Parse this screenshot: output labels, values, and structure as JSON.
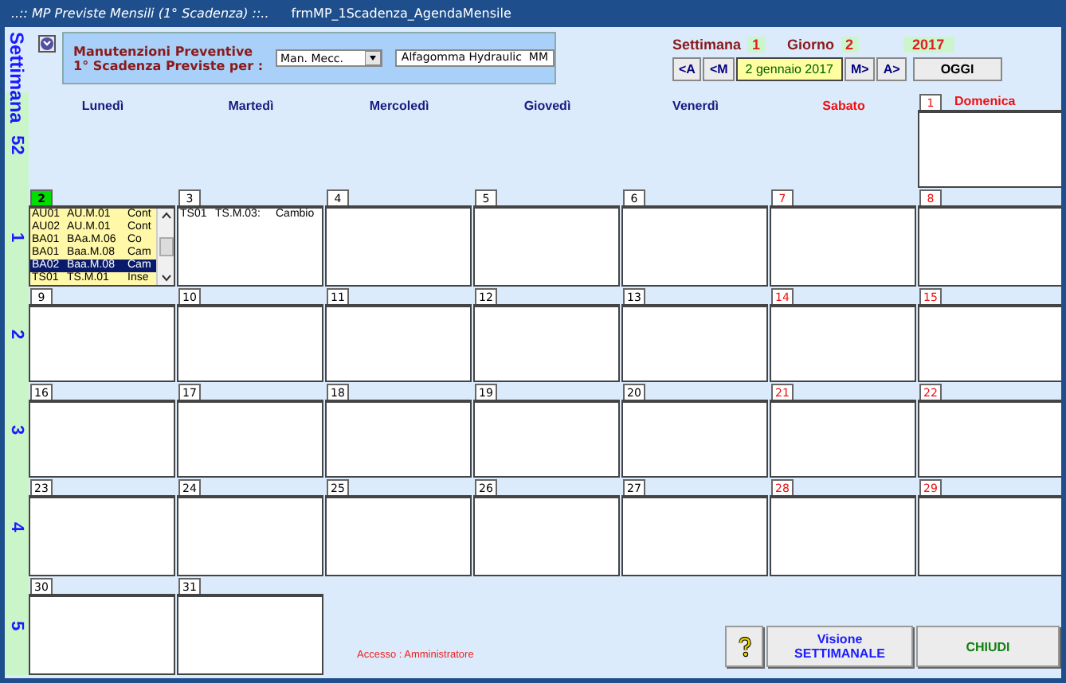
{
  "window": {
    "title": "..:: MP Previste Mensili (1° Scadenza) ::..",
    "form_name": "frmMP_1Scadenza_AgendaMensile"
  },
  "strip_title": "Settimana",
  "filter": {
    "label_line1": "Manutenzioni Preventive",
    "label_line2": "1° Scadenza Previste per :",
    "category": "Man. Mecc.",
    "company": "Alfagomma Hydraulic  MM"
  },
  "navigation": {
    "week_label": "Settimana",
    "week": "1",
    "day_label": "Giorno",
    "day": "2",
    "year": "2017",
    "buttons_before": [
      "<A",
      "<M"
    ],
    "date": "2 gennaio 2017",
    "buttons_after": [
      "M>",
      "A>"
    ],
    "today_button": "OGGI"
  },
  "weekdays": [
    {
      "label": "Lunedì",
      "holiday": false
    },
    {
      "label": "Martedì",
      "holiday": false
    },
    {
      "label": "Mercoledì",
      "holiday": false
    },
    {
      "label": "Giovedì",
      "holiday": false
    },
    {
      "label": "Venerdì",
      "holiday": false
    },
    {
      "label": "Sabato",
      "holiday": true
    },
    {
      "label": "Domenica",
      "holiday": true
    }
  ],
  "weeks": [
    {
      "number": "52",
      "days": [
        {
          "number": "1",
          "holiday": true,
          "today": false
        }
      ]
    },
    {
      "number": "1",
      "days": [
        {
          "number": "2",
          "holiday": false,
          "today": true,
          "entries": [
            {
              "code": "AU01",
              "plan": "AU.M.01",
              "desc": "Cont",
              "selected": false
            },
            {
              "code": "AU02",
              "plan": "AU.M.01",
              "desc": "Cont",
              "selected": false
            },
            {
              "code": "BA01",
              "plan": "BAa.M.06",
              "desc": "Co",
              "selected": false
            },
            {
              "code": "BA01",
              "plan": "Baa.M.08",
              "desc": "Cam",
              "selected": false
            },
            {
              "code": "BA02",
              "plan": "Baa.M.08",
              "desc": "Cam",
              "selected": true
            },
            {
              "code": "TS01",
              "plan": "TS.M.01",
              "desc": "Inse",
              "selected": false
            }
          ]
        },
        {
          "number": "3",
          "holiday": false,
          "today": false,
          "entries": [
            {
              "code": "TS01",
              "plan": "TS.M.03:",
              "desc": "Cambio",
              "selected": false
            }
          ]
        },
        {
          "number": "4",
          "holiday": false,
          "today": false
        },
        {
          "number": "5",
          "holiday": false,
          "today": false
        },
        {
          "number": "6",
          "holiday": false,
          "today": false
        },
        {
          "number": "7",
          "holiday": true,
          "today": false
        },
        {
          "number": "8",
          "holiday": true,
          "today": false
        }
      ]
    },
    {
      "number": "2",
      "days": [
        {
          "number": "9",
          "holiday": false,
          "today": false
        },
        {
          "number": "10",
          "holiday": false,
          "today": false
        },
        {
          "number": "11",
          "holiday": false,
          "today": false
        },
        {
          "number": "12",
          "holiday": false,
          "today": false
        },
        {
          "number": "13",
          "holiday": false,
          "today": false
        },
        {
          "number": "14",
          "holiday": true,
          "today": false
        },
        {
          "number": "15",
          "holiday": true,
          "today": false
        }
      ]
    },
    {
      "number": "3",
      "days": [
        {
          "number": "16",
          "holiday": false,
          "today": false
        },
        {
          "number": "17",
          "holiday": false,
          "today": false
        },
        {
          "number": "18",
          "holiday": false,
          "today": false
        },
        {
          "number": "19",
          "holiday": false,
          "today": false
        },
        {
          "number": "20",
          "holiday": false,
          "today": false
        },
        {
          "number": "21",
          "holiday": true,
          "today": false
        },
        {
          "number": "22",
          "holiday": true,
          "today": false
        }
      ]
    },
    {
      "number": "4",
      "days": [
        {
          "number": "23",
          "holiday": false,
          "today": false
        },
        {
          "number": "24",
          "holiday": false,
          "today": false
        },
        {
          "number": "25",
          "holiday": false,
          "today": false
        },
        {
          "number": "26",
          "holiday": false,
          "today": false
        },
        {
          "number": "27",
          "holiday": false,
          "today": false
        },
        {
          "number": "28",
          "holiday": true,
          "today": false
        },
        {
          "number": "29",
          "holiday": true,
          "today": false
        }
      ]
    },
    {
      "number": "5",
      "days": [
        {
          "number": "30",
          "holiday": false,
          "today": false
        },
        {
          "number": "31",
          "holiday": false,
          "today": false
        }
      ]
    }
  ],
  "footer": {
    "access": "Accesso : Amministratore",
    "weekly_button_line1": "Visione",
    "weekly_button_line2": "SETTIMANALE",
    "close_button": "CHIUDI"
  }
}
